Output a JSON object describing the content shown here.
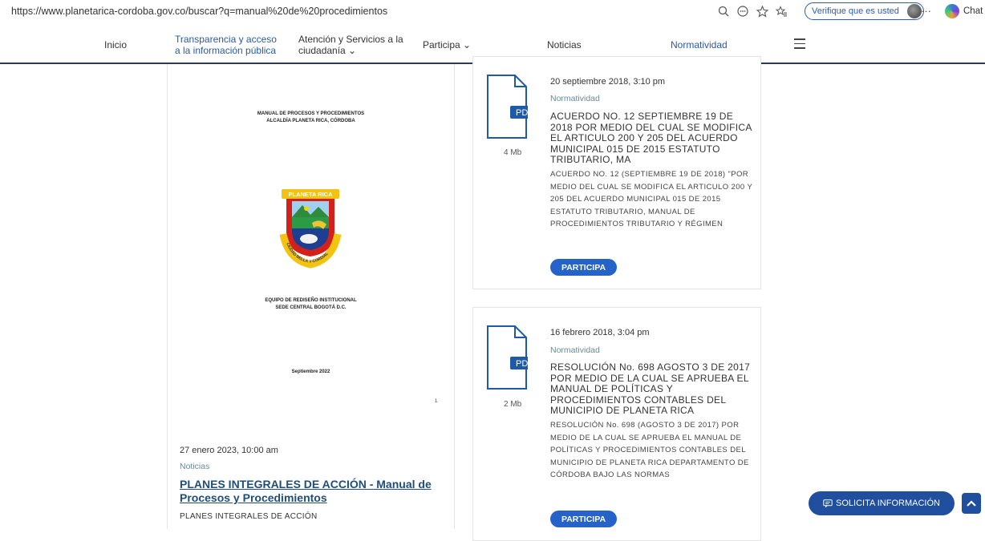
{
  "browser": {
    "url": "https://www.planetarica-cordoba.gov.co/buscar?q=manual%20de%20procedimientos",
    "verify_label": "Verifique que es usted",
    "chat_label": "Chat",
    "more_label": "···"
  },
  "nav": {
    "items": [
      {
        "label": "Inicio"
      },
      {
        "line1": "Transparencia y acceso",
        "line2": "a la información pública"
      },
      {
        "line1": "Atención y Servicios a la",
        "line2": "ciudadanía ⌄"
      },
      {
        "label": "Participa ⌄"
      },
      {
        "label": "Noticias"
      },
      {
        "label": "Normatividad"
      }
    ]
  },
  "left_result": {
    "doc": {
      "title1": "MANUAL DE PROCESOS Y PROCEDIMIENTOS",
      "title2": "ALCALDÍA PLANETA RICA, CÓRDOBA",
      "shield_banner": "PLANETA RICA",
      "shield_motto": "CIUDAD BELLA Y CORDIAL",
      "team1": "EQUIPO DE REDISEÑO INSTITUCIONAL",
      "team2": "SEDE CENTRAL BOGOTÁ D.C.",
      "date": "Septiembre 2022",
      "page": "1"
    },
    "date": "27 enero 2023, 10:00 am",
    "category": "Noticias",
    "title": "PLANES INTEGRALES DE ACCIÓN - Manual de Procesos y Procedimientos",
    "summary": "PLANES INTEGRALES DE ACCIÓN"
  },
  "right_results": [
    {
      "file_type": "PDF",
      "size": "4 Mb",
      "date": "20 septiembre 2018, 3:10 pm",
      "category": "Normatividad",
      "title": "ACUERDO NO. 12 SEPTIEMBRE 19 DE 2018 POR MEDIO DEL CUAL SE MODIFICA EL ARTICULO 200 Y 205 DEL ACUERDO MUNICIPAL 015 DE 2015 ESTATUTO TRIBUTARIO, MA",
      "summary": "ACUERDO NO. 12 (SEPTIEMBRE 19 DE 2018) \"POR MEDIO DEL CUAL SE MODIFICA EL ARTICULO 200 Y 205 DEL ACUERDO MUNICIPAL 015 DE 2015 ESTATUTO TRIBUTARIO, MANUAL DE PROCEDIMIENTOS TRIBUTARIO Y RÉGIMEN",
      "button": "PARTICIPA"
    },
    {
      "file_type": "PDF",
      "size": "2 Mb",
      "date": "16 febrero 2018, 3:04 pm",
      "category": "Normatividad",
      "title": "RESOLUCIÓN No. 698 AGOSTO 3 DE 2017 POR MEDIO DE LA CUAL SE APRUEBA EL MANUAL DE POLÍTICAS Y PROCEDIMIENTOS CONTABLES DEL MUNICIPIO DE PLANETA RICA",
      "summary": "RESOLUCIÓN No. 698 (AGOSTO 3 DE 2017) POR MEDIO DE LA CUAL SE APRUEBA EL MANUAL DE POLÍTICAS Y PROCEDIMIENTOS CONTABLES DEL MUNICIPIO DE PLANETA RICA DEPARTAMENTO DE CÓRDOBA BAJO LAS NORMAS",
      "button": "PARTICIPA"
    }
  ],
  "floating": {
    "solicita_label": "SOLICITA INFORMACIÓN"
  },
  "colors": {
    "nav_border": "#2b3b55",
    "link_blue": "#1f4e79",
    "button_blue": "#2563c9",
    "floating_blue": "#1f4f9e",
    "pdf_blue": "#1f5aa8"
  }
}
